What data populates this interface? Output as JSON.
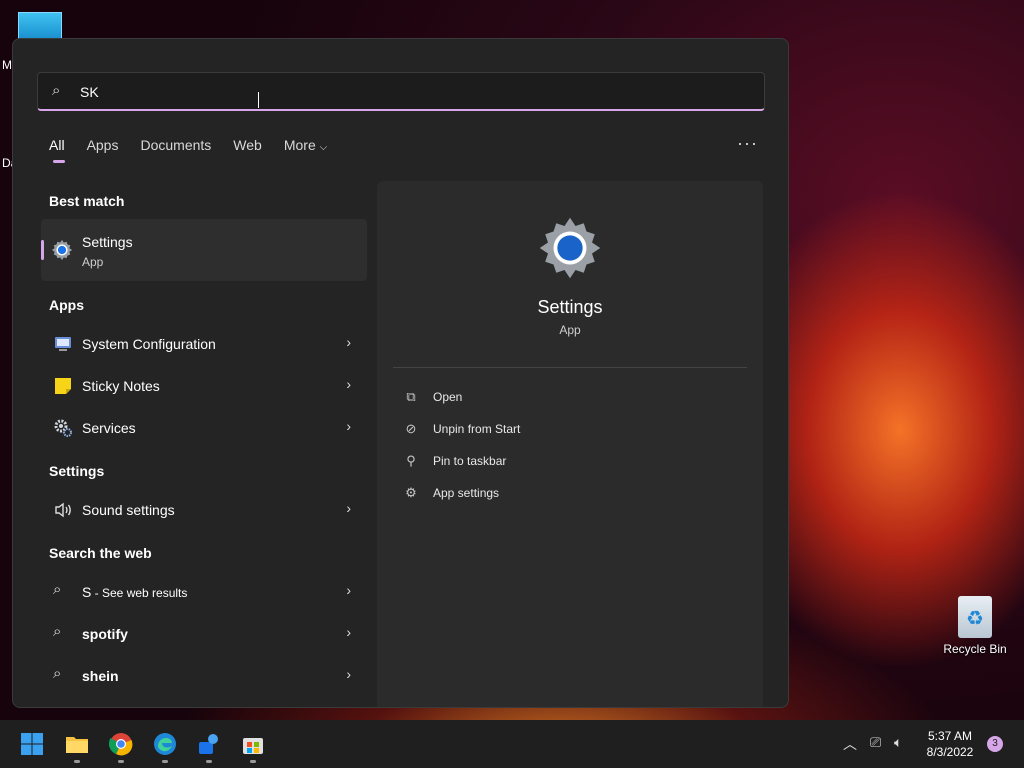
{
  "desktop": {
    "partial_labels": [
      "M",
      "Da"
    ],
    "recycle_bin_label": "Recycle Bin"
  },
  "search": {
    "value": "SK",
    "icon": "search-icon"
  },
  "tabs": [
    {
      "label": "All",
      "active": true
    },
    {
      "label": "Apps",
      "active": false
    },
    {
      "label": "Documents",
      "active": false
    },
    {
      "label": "Web",
      "active": false
    },
    {
      "label": "More",
      "active": false
    }
  ],
  "more_options_icon": "ellipsis-icon",
  "best_match": {
    "heading": "Best match",
    "title": "Settings",
    "subtitle": "App"
  },
  "apps": {
    "heading": "Apps",
    "items": [
      {
        "label": "System Configuration",
        "icon": "system-configuration-icon"
      },
      {
        "label": "Sticky Notes",
        "icon": "sticky-notes-icon"
      },
      {
        "label": "Services",
        "icon": "services-icon"
      }
    ]
  },
  "settings_section": {
    "heading": "Settings",
    "items": [
      {
        "label": "Sound settings",
        "icon": "speaker-icon"
      }
    ]
  },
  "web": {
    "heading": "Search the web",
    "items": [
      {
        "label": "S",
        "suffix": " - See web results"
      },
      {
        "label": "spotify"
      },
      {
        "label": "shein"
      }
    ]
  },
  "preview": {
    "title": "Settings",
    "subtitle": "App",
    "actions": [
      {
        "label": "Open",
        "icon": "open-external-icon"
      },
      {
        "label": "Unpin from Start",
        "icon": "unpin-icon"
      },
      {
        "label": "Pin to taskbar",
        "icon": "pin-icon"
      },
      {
        "label": "App settings",
        "icon": "gear-icon"
      }
    ]
  },
  "taskbar": {
    "apps": [
      "windows-start",
      "file-explorer",
      "chrome",
      "edge",
      "feedback-hub",
      "microsoft-store"
    ],
    "time": "5:37 AM",
    "date": "8/3/2022",
    "notification_count": "3"
  },
  "colors": {
    "accent": "#d6a6e8",
    "panel": "#242424",
    "preview_pane": "#2b2b2b"
  }
}
